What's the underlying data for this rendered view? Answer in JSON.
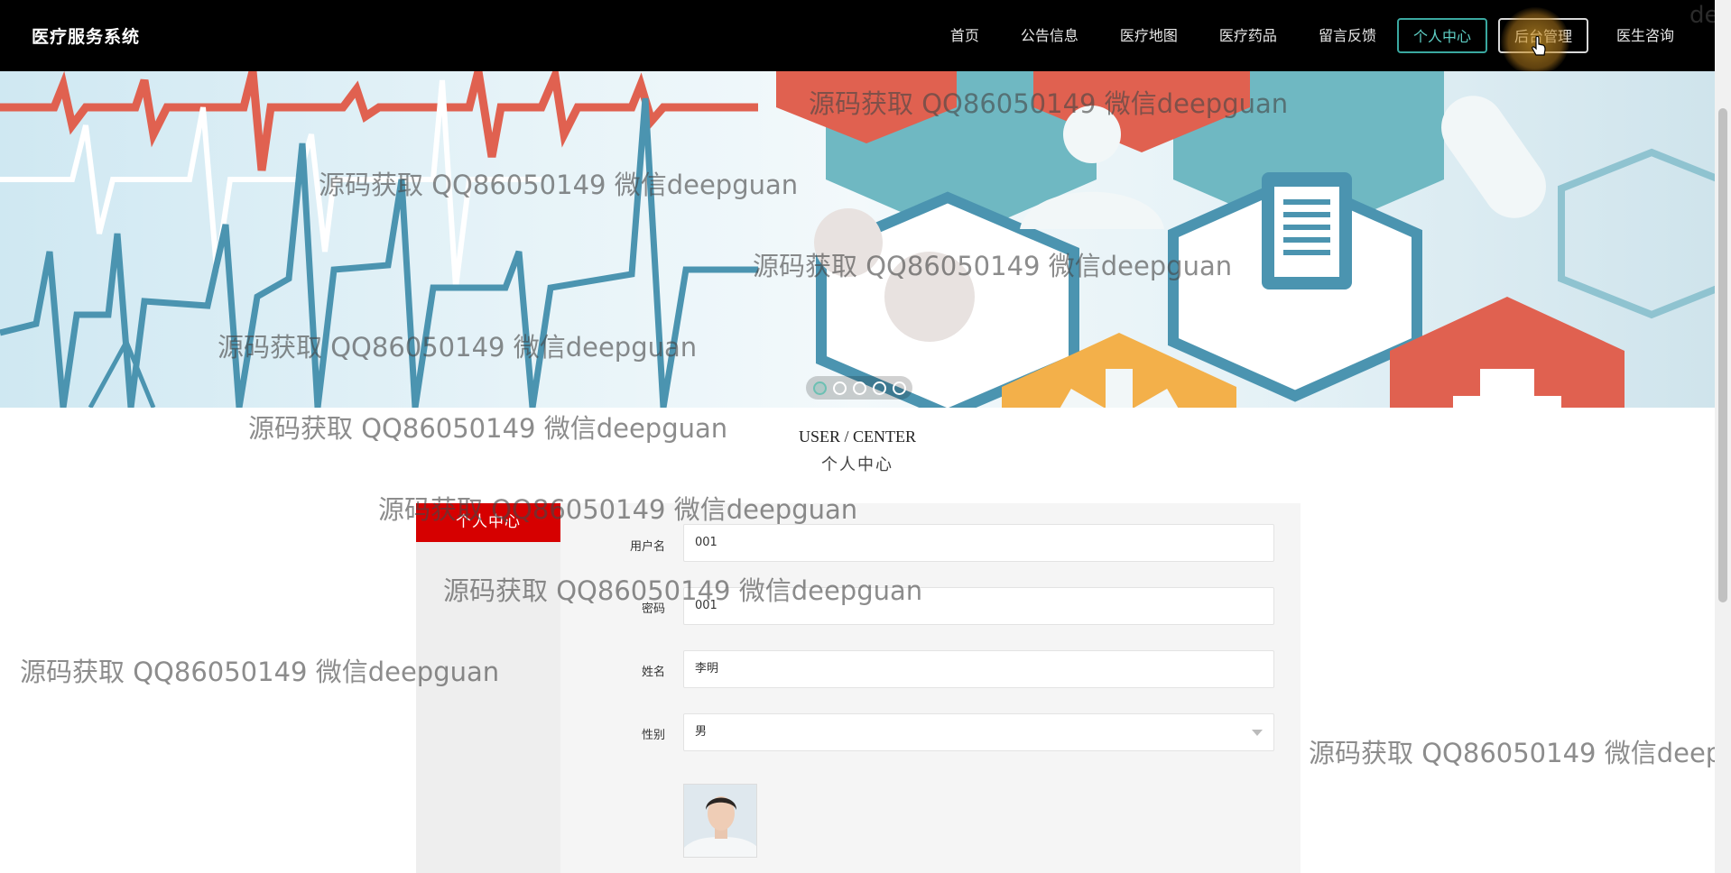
{
  "app": {
    "title": "医疗服务系统"
  },
  "nav": {
    "items": [
      "首页",
      "公告信息",
      "医疗地图",
      "医疗药品",
      "留言反馈"
    ],
    "user_center": "个人中心",
    "admin": "后台管理",
    "doctor": "医生咨询"
  },
  "banner": {
    "slide_count": 5,
    "active_slide": 1
  },
  "section": {
    "title_en": "USER / CENTER",
    "title_cn": "个人中心"
  },
  "sidebar": {
    "active_item": "个人中心"
  },
  "form": {
    "username": {
      "label": "用户名",
      "value": "001"
    },
    "password": {
      "label": "密码",
      "value": "001"
    },
    "name": {
      "label": "姓名",
      "value": "李明"
    },
    "gender": {
      "label": "性别",
      "value": "男"
    }
  },
  "watermark": {
    "text": "源码获取 QQ86050149 微信deepguan",
    "text_partial": "源码获取 QQ86050149 微信deepg",
    "corner_fragment": "de"
  },
  "colors": {
    "accent_red": "#d60000",
    "accent_teal": "#3aa8a0",
    "nav_bg": "#000000"
  }
}
